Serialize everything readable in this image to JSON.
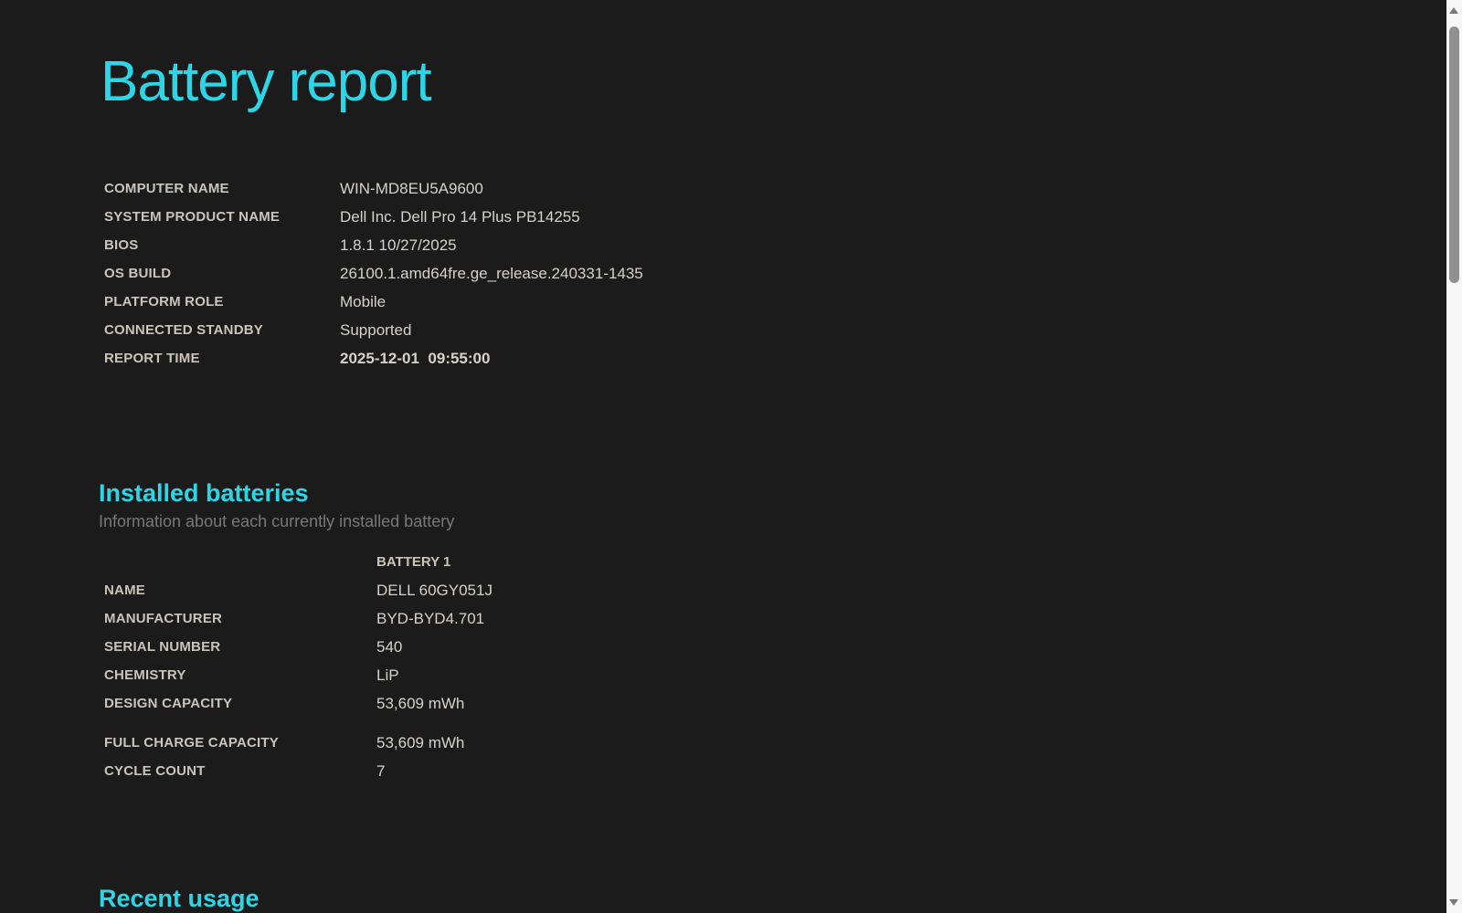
{
  "page": {
    "title": "Battery report",
    "accent_color": "#2dd5e6",
    "background_color": "#1b1b1b"
  },
  "system_info": {
    "rows": [
      {
        "label": "COMPUTER NAME",
        "value": "WIN-MD8EU5A9600"
      },
      {
        "label": "SYSTEM PRODUCT NAME",
        "value": "Dell Inc. Dell Pro 14 Plus PB14255"
      },
      {
        "label": "BIOS",
        "value": "1.8.1 10/27/2025"
      },
      {
        "label": "OS BUILD",
        "value": "26100.1.amd64fre.ge_release.240331-1435"
      },
      {
        "label": "PLATFORM ROLE",
        "value": "Mobile"
      },
      {
        "label": "CONNECTED STANDBY",
        "value": "Supported"
      },
      {
        "label": "REPORT TIME",
        "value": "2025-12-01  09:55:00"
      }
    ]
  },
  "installed_batteries": {
    "heading": "Installed batteries",
    "subtitle": "Information about each currently installed battery",
    "column_header": "BATTERY 1",
    "rows_group1": [
      {
        "label": "NAME",
        "value": "DELL 60GY051J"
      },
      {
        "label": "MANUFACTURER",
        "value": "BYD-BYD4.701"
      },
      {
        "label": "SERIAL NUMBER",
        "value": "540"
      },
      {
        "label": "CHEMISTRY",
        "value": "LiP"
      },
      {
        "label": "DESIGN CAPACITY",
        "value": "53,609 mWh"
      }
    ],
    "rows_group2": [
      {
        "label": "FULL CHARGE CAPACITY",
        "value": "53,609 mWh"
      },
      {
        "label": "CYCLE COUNT",
        "value": "7"
      }
    ]
  },
  "recent_usage": {
    "heading": "Recent usage"
  }
}
